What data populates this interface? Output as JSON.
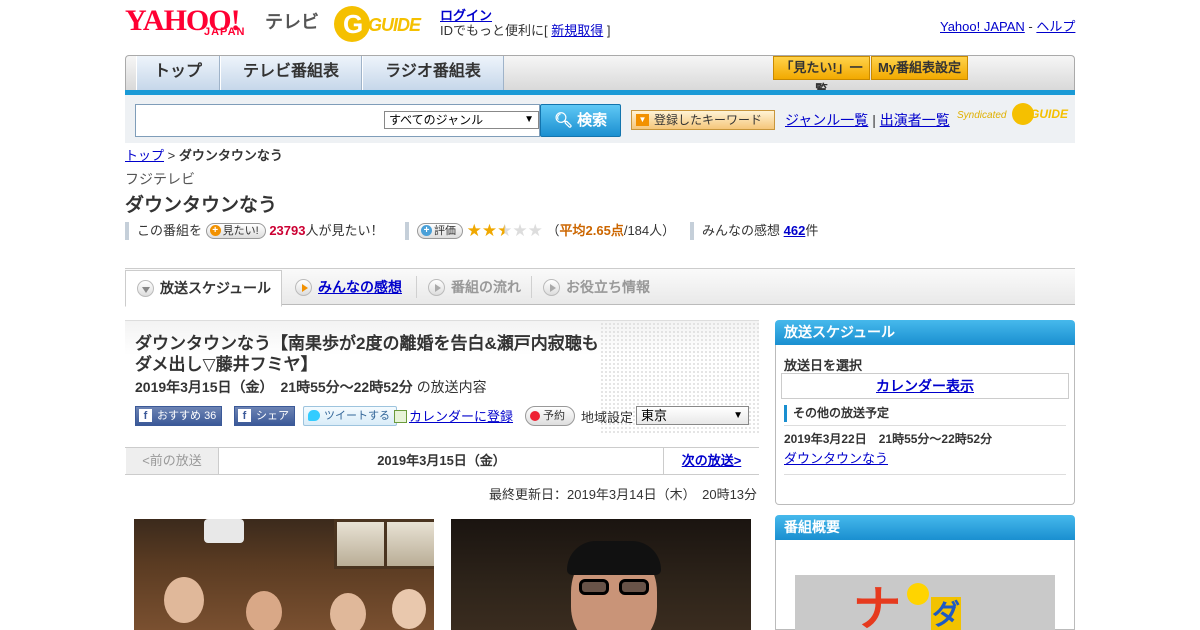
{
  "header": {
    "logo_yahoo": "YAHOO!",
    "logo_japan": "JAPAN",
    "logo_tv": "テレビ",
    "logo_gguide": "GUIDE",
    "login": "ログイン",
    "id_prefix": "IDでもっと便利に[",
    "signup": "新規取得",
    "id_suffix": "]",
    "link_yahoo": "Yahoo! JAPAN",
    "link_sep": "-",
    "link_help": "ヘルプ"
  },
  "nav": {
    "tabs": [
      "トップ",
      "テレビ番組表",
      "ラジオ番組表"
    ],
    "mitai_list": "「見たい!」一覧",
    "my_bangumi": "My番組表設定"
  },
  "search": {
    "query": "",
    "genre_selected": "すべてのジャンル",
    "button": "検索",
    "keyword_button": "登録したキーワード",
    "genre_list": "ジャンル一覧",
    "separator": "|",
    "performer_list": "出演者一覧",
    "syndicated": "Syndicated",
    "synd_logo": "GUIDE"
  },
  "breadcrumb": {
    "top": "トップ",
    "sep": ">",
    "current": "ダウンタウンなう"
  },
  "program": {
    "channel": "フジテレビ",
    "title": "ダウンタウンなう",
    "mitai_prefix": "この番組を",
    "mitai_button": "見たい!",
    "mitai_count": "23793",
    "mitai_suffix": "人が見たい！",
    "rating_button": "評価",
    "rating_value": 2.65,
    "rating_open": "（",
    "rating_avg": "平均2.65点",
    "rating_count": "/184人）",
    "kansou_label": "みんなの感想",
    "kansou_count": "462",
    "kansou_unit": "件"
  },
  "tabs": [
    {
      "label": "放送スケジュール",
      "state": "active"
    },
    {
      "label": "みんなの感想",
      "state": "link"
    },
    {
      "label": "番組の流れ",
      "state": "disabled"
    },
    {
      "label": "お役立ち情報",
      "state": "disabled"
    }
  ],
  "episode": {
    "title": "ダウンタウンなう【南果歩が2度の離婚を告白&瀬戸内寂聴もダメ出し▽藤井フミヤ】",
    "date": "2019年3月15日（金）　21時55分～22時52分",
    "date_suffix": "の放送内容",
    "fb_recommend": "おすすめ",
    "fb_count": "36",
    "fb_share": "シェア",
    "tweet": "ツイートする",
    "calendar": "カレンダーに登録",
    "reserve": "予約",
    "area_label": "地域設定",
    "area_selected": "東京"
  },
  "pager": {
    "prev": "<前の放送",
    "current": "2019年3月15日（金）",
    "next": "次の放送>"
  },
  "updated": "最終更新日：2019年3月14日（木）　20時13分",
  "sidebar": {
    "schedule_head": "放送スケジュール",
    "select_date": "放送日を選択",
    "calendar_button": "カレンダー表示",
    "other_head": "その他の放送予定",
    "other_date": "2019年3月22日　21時55分～22時52分",
    "other_link": "ダウンタウンなう",
    "overview_head": "番組概要",
    "poster_text": "ナウダ"
  },
  "colors": {
    "accent_blue": "#1a9ad6",
    "link": "#0000cc",
    "yahoo_red": "#ff0033",
    "gguide_yellow": "#f5c000",
    "count_red": "#cc0033"
  }
}
